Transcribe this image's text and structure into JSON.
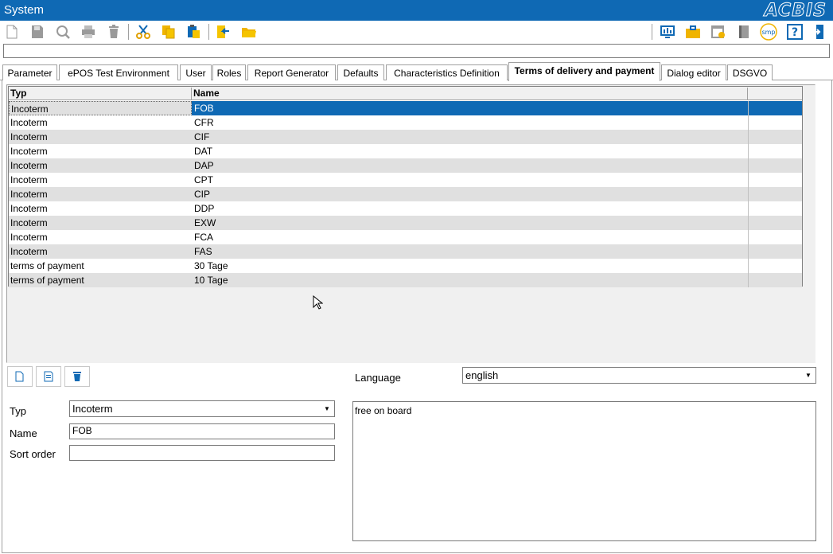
{
  "window": {
    "title": "System",
    "logo": "ACBIS"
  },
  "toolbar": {
    "left_icons": [
      "new-document-icon",
      "save-icon",
      "search-icon",
      "print-icon",
      "delete-icon",
      "cut-icon",
      "copy-icon",
      "paste-icon",
      "import-icon",
      "open-folder-icon"
    ],
    "right_icons": [
      "monitor-report-icon",
      "briefcase-icon",
      "calendar-icon",
      "book-icon",
      "smp-icon",
      "help-icon",
      "exit-door-icon"
    ],
    "smp_label": "smp",
    "help_label": "?"
  },
  "tabs": [
    {
      "label": "Parameter"
    },
    {
      "label": "ePOS Test Environment"
    },
    {
      "label": "User"
    },
    {
      "label": "Roles"
    },
    {
      "label": "Report Generator"
    },
    {
      "label": "Defaults"
    },
    {
      "label": "Characteristics Definition"
    },
    {
      "label": "Terms of delivery and payment"
    },
    {
      "label": "Dialog editor"
    },
    {
      "label": "DSGVO"
    }
  ],
  "active_tab": "Terms of delivery and payment",
  "grid": {
    "columns": [
      "Typ",
      "Name"
    ],
    "rows": [
      [
        "Incoterm",
        "FOB"
      ],
      [
        "Incoterm",
        "CFR"
      ],
      [
        "Incoterm",
        "CIF"
      ],
      [
        "Incoterm",
        "DAT"
      ],
      [
        "Incoterm",
        "DAP"
      ],
      [
        "Incoterm",
        "CPT"
      ],
      [
        "Incoterm",
        "CIP"
      ],
      [
        "Incoterm",
        "DDP"
      ],
      [
        "Incoterm",
        "EXW"
      ],
      [
        "Incoterm",
        "FCA"
      ],
      [
        "Incoterm",
        "FAS"
      ],
      [
        "terms of payment",
        "30 Tage"
      ],
      [
        "terms of payment",
        "10 Tage"
      ]
    ],
    "selected_row": 0
  },
  "form": {
    "language_label": "Language",
    "language_value": "english",
    "typ_label": "Typ",
    "typ_value": "Incoterm",
    "name_label": "Name",
    "name_value": "FOB",
    "sort_label": "Sort order",
    "sort_value": "",
    "description": "free on board",
    "dropdown_arrow": "▼"
  },
  "colors": {
    "accent": "#0f69b4",
    "row_alt": "#e0e0e0"
  }
}
